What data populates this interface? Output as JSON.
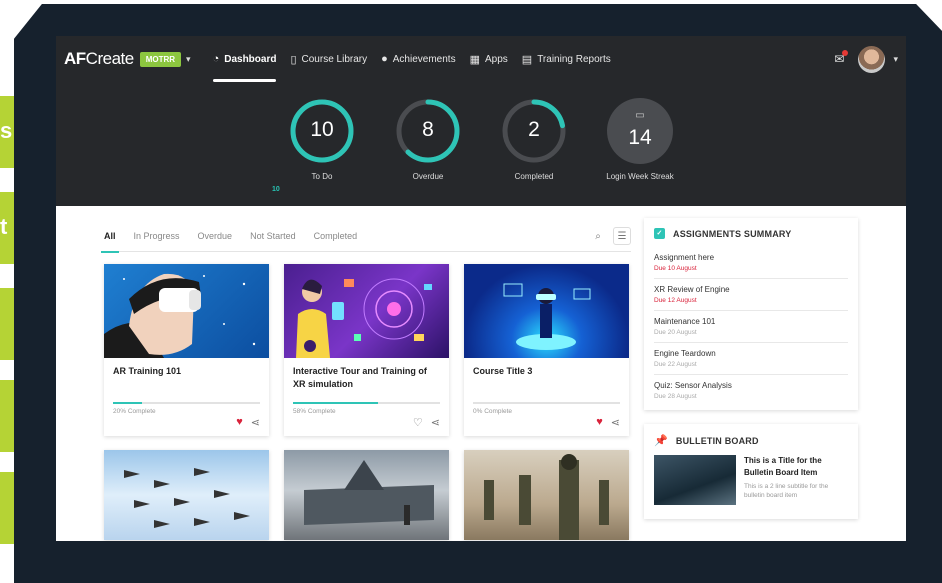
{
  "side_tabs": [
    "s",
    "t",
    "",
    "",
    ""
  ],
  "nav": {
    "logo_bold": "AF",
    "logo_light": "Create",
    "org_badge": "MOTRR",
    "items": [
      {
        "label": "Dashboard",
        "icon": "dashboard-icon",
        "active": true
      },
      {
        "label": "Course Library",
        "icon": "book-icon"
      },
      {
        "label": "Achievements",
        "icon": "trophy-icon"
      },
      {
        "label": "Apps",
        "icon": "grid-icon"
      },
      {
        "label": "Training Reports",
        "icon": "report-icon"
      }
    ]
  },
  "stats": [
    {
      "value": "10",
      "label": "To Do",
      "fraction": 1.0
    },
    {
      "value": "8",
      "label": "Overdue",
      "fraction": 0.62
    },
    {
      "value": "2",
      "label": "Completed",
      "fraction": 0.22
    },
    {
      "value": "14",
      "label": "Login Week Streak"
    }
  ],
  "stats_small_label": "10",
  "filters": [
    "All",
    "In Progress",
    "Overdue",
    "Not Started",
    "Completed"
  ],
  "courses": [
    {
      "title": "AR Training 101",
      "progress_text": "20% Complete",
      "progress": 0.2,
      "favorite": true
    },
    {
      "title": "Interactive Tour and Training of XR simulation",
      "progress_text": "58% Complete",
      "progress": 0.58,
      "favorite": false
    },
    {
      "title": "Course Title 3",
      "progress_text": "0% Complete",
      "progress": 0.0,
      "favorite": true
    }
  ],
  "assignments": {
    "title": "ASSIGNMENTS SUMMARY",
    "items": [
      {
        "name": "Assignment here",
        "due": "Due 10 August",
        "overdue": true
      },
      {
        "name": "XR Review of Engine",
        "due": "Due 12 August",
        "overdue": true
      },
      {
        "name": "Maintenance 101",
        "due": "Due 20 August",
        "overdue": false
      },
      {
        "name": "Engine Teardown",
        "due": "Due 22 August",
        "overdue": false
      },
      {
        "name": "Quiz: Sensor Analysis",
        "due": "Due 28 August",
        "overdue": false
      }
    ]
  },
  "bulletin": {
    "title": "BULLETIN BOARD",
    "item_title": "This is a Title for the Bulletin Board Item",
    "item_sub": "This is a 2 line subtitle for the bulletin board item"
  },
  "colors": {
    "accent": "#2ec4b6",
    "brand_badge": "#8cc63f",
    "favorite": "#d9233b",
    "side_tab": "#b5d335"
  }
}
